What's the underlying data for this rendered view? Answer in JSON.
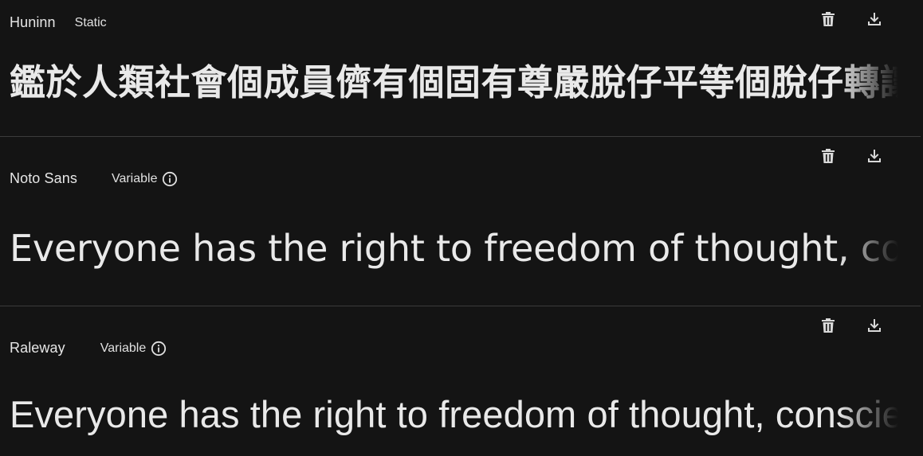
{
  "fonts": [
    {
      "name": "Huninn",
      "style_label": "Static",
      "has_info": false,
      "preview": "鑑於人類社會個成員儕有個固有尊嚴脫仔平等個脫仔轉讓個權利",
      "actions": {
        "delete": "delete-icon",
        "download": "download-icon"
      }
    },
    {
      "name": "Noto Sans",
      "style_label": "Variable",
      "has_info": true,
      "preview": "Everyone has the right to freedom of thought, conscience and religion",
      "actions": {
        "delete": "delete-icon",
        "download": "download-icon"
      }
    },
    {
      "name": "Raleway",
      "style_label": "Variable",
      "has_info": true,
      "preview": "Everyone has the right to freedom of thought, conscience and religion",
      "actions": {
        "delete": "delete-icon",
        "download": "download-icon"
      }
    }
  ],
  "colors": {
    "background": "#141414",
    "divider": "#3c3c3c",
    "text": "#e3e3e3"
  }
}
